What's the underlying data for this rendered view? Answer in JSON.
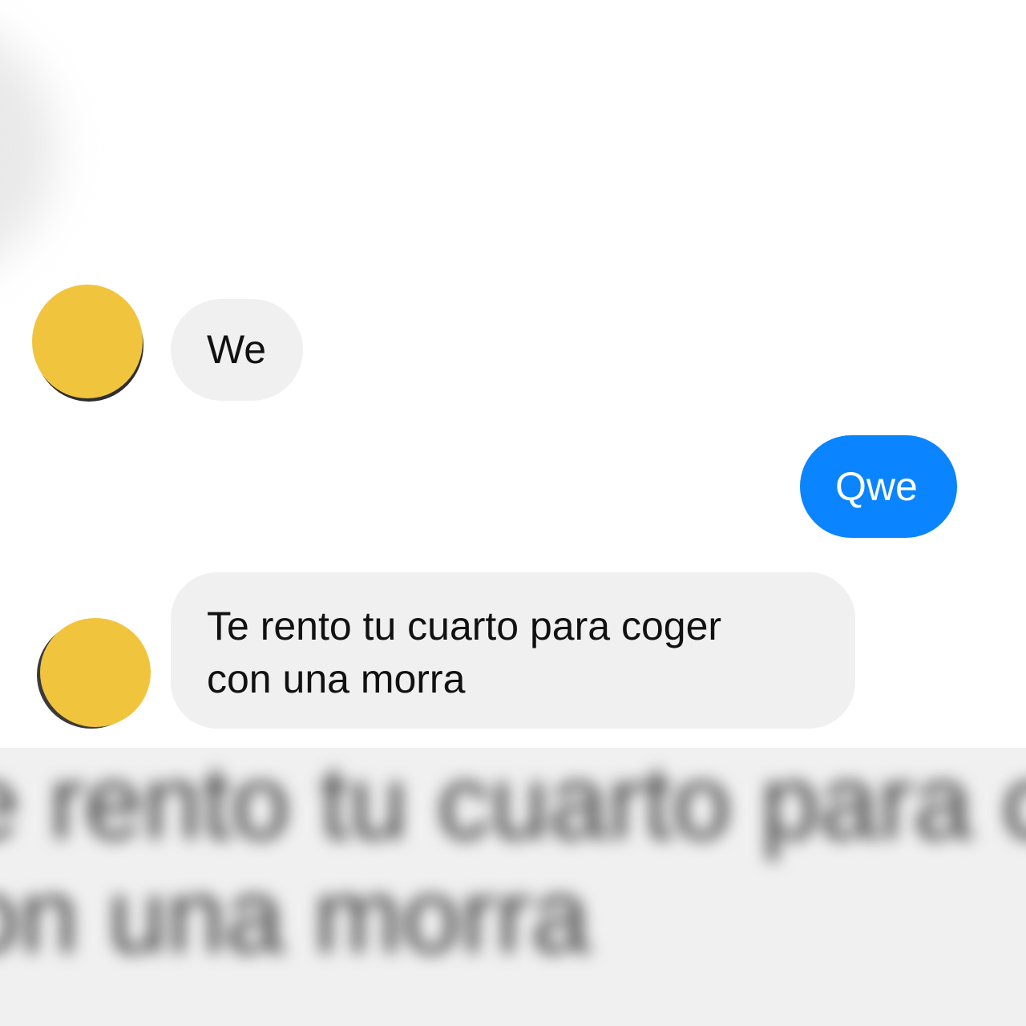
{
  "colors": {
    "background": "#ffffff",
    "incoming_bubble": "#f0f0f0",
    "outgoing_bubble": "#0a84ff",
    "avatar": "#f1c43e"
  },
  "messages": [
    {
      "sender": "contact",
      "text": "We"
    },
    {
      "sender": "me",
      "text": "Qwe"
    },
    {
      "sender": "contact",
      "line1": "Te rento tu cuarto para coger",
      "line2": "con una morra"
    }
  ],
  "zoom_overlay": {
    "line1": "Te rento tu cuarto para coger",
    "line2": "con una morra"
  }
}
